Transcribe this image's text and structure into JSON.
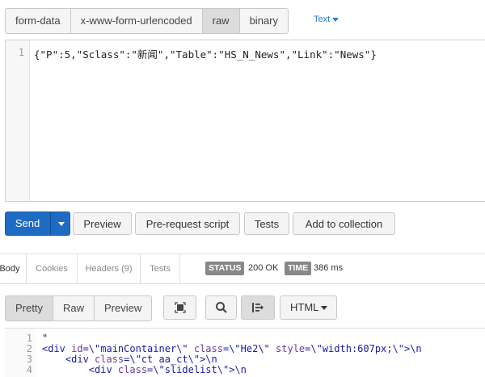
{
  "body_tabs": [
    "form-data",
    "x-www-form-urlencoded",
    "raw",
    "binary"
  ],
  "text_select": "Text",
  "editor": {
    "line_number": "1",
    "content": "{\"P\":5,\"Sclass\":\"新闻\",\"Table\":\"HS_N_News\",\"Link\":\"News\"}"
  },
  "actions": {
    "send": "Send",
    "preview": "Preview",
    "pre_request": "Pre-request script",
    "tests": "Tests",
    "add_collection": "Add to collection"
  },
  "response_tabs": {
    "body": "Body",
    "cookies": "Cookies",
    "headers": "Headers (9)",
    "tests": "Tests"
  },
  "status": {
    "label": "STATUS",
    "value": "200 OK"
  },
  "time": {
    "label": "TIME",
    "value": "386 ms"
  },
  "view_tabs": [
    "Pretty",
    "Raw",
    "Preview"
  ],
  "format_select": "HTML",
  "response_lines": [
    {
      "n": "1",
      "parts": [
        {
          "t": "\"",
          "c": "plain"
        }
      ]
    },
    {
      "n": "2",
      "parts": [
        {
          "t": "<div ",
          "c": "tag"
        },
        {
          "t": "id",
          "c": "attr"
        },
        {
          "t": "=\\\"mainContainer\\\" ",
          "c": "str"
        },
        {
          "t": "class",
          "c": "attr"
        },
        {
          "t": "=\\\"He2\\\" ",
          "c": "str"
        },
        {
          "t": "style",
          "c": "attr"
        },
        {
          "t": "=\\\"width:607px;\\\"",
          "c": "str"
        },
        {
          "t": ">\\n",
          "c": "tag"
        }
      ]
    },
    {
      "n": "3",
      "parts": [
        {
          "t": "    <div ",
          "c": "tag"
        },
        {
          "t": "class",
          "c": "attr"
        },
        {
          "t": "=\\\"ct aa_ct\\\"",
          "c": "str"
        },
        {
          "t": ">\\n",
          "c": "tag"
        }
      ]
    },
    {
      "n": "4",
      "parts": [
        {
          "t": "        <div ",
          "c": "tag"
        },
        {
          "t": "class",
          "c": "attr"
        },
        {
          "t": "=\\\"slidelist\\\"",
          "c": "str"
        },
        {
          "t": ">\\n",
          "c": "tag"
        }
      ]
    }
  ]
}
